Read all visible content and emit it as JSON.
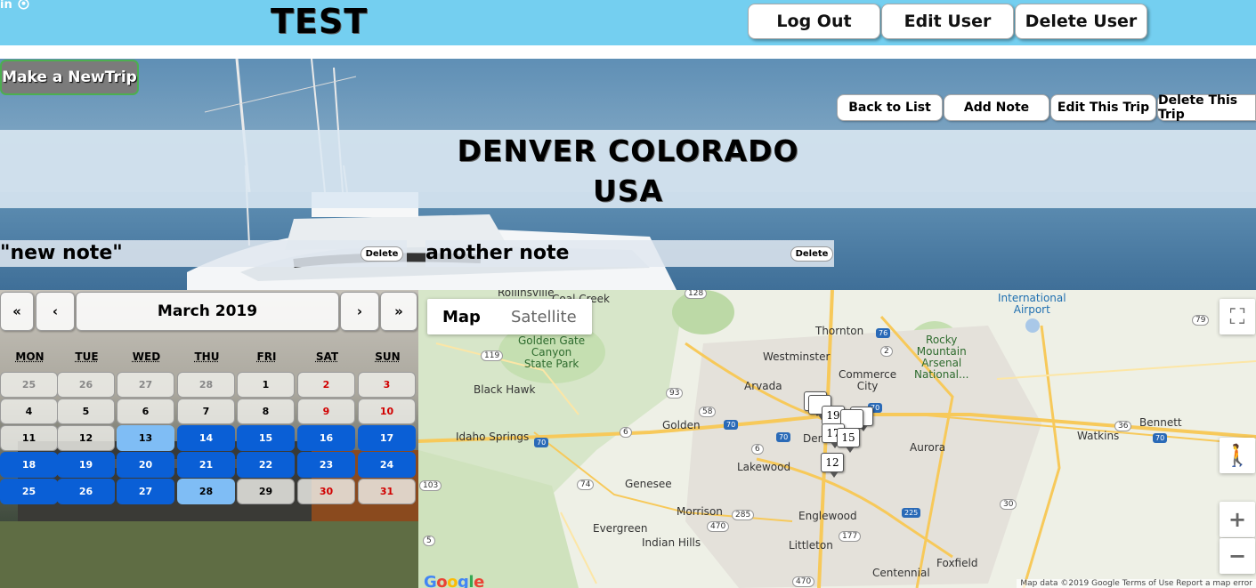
{
  "header": {
    "icons": [
      "in",
      "github-icon"
    ],
    "title": "TEST",
    "buttons": {
      "logout": "Log Out",
      "edit_user": "Edit User",
      "delete_user": "Delete User"
    }
  },
  "trip": {
    "new_trip_label": "Make a NewTrip",
    "actions": {
      "back": "Back to List",
      "add_note": "Add Note",
      "edit": "Edit This Trip",
      "delete": "Delete This Trip"
    },
    "destination": {
      "city": "DENVER COLORADO",
      "country": "USA"
    },
    "notes": [
      {
        "text": "\"new note\"",
        "delete_label": "Delete"
      },
      {
        "text": "another note",
        "delete_label": "Delete"
      }
    ]
  },
  "calendar": {
    "nav": {
      "prev_year": "«",
      "prev_month": "‹",
      "month_label": "March 2019",
      "next_month": "›",
      "next_year": "»"
    },
    "weekdays": [
      "MON",
      "TUE",
      "WED",
      "THU",
      "FRI",
      "SAT",
      "SUN"
    ],
    "weeks": [
      [
        "25",
        "26",
        "27",
        "28",
        "1",
        "2",
        "3"
      ],
      [
        "4",
        "5",
        "6",
        "7",
        "8",
        "9",
        "10"
      ],
      [
        "11",
        "12",
        "13",
        "14",
        "15",
        "16",
        "17"
      ],
      [
        "18",
        "19",
        "20",
        "21",
        "22",
        "23",
        "24"
      ],
      [
        "25",
        "26",
        "27",
        "28",
        "29",
        "30",
        "31"
      ]
    ],
    "selected_range": [
      "13",
      "28"
    ]
  },
  "map": {
    "toggle": {
      "map": "Map",
      "satellite": "Satellite"
    },
    "places": {
      "international_airport": "International\nAirport",
      "thornton": "Thornton",
      "westminster": "Westminster",
      "arvada": "Arvada",
      "commerce_city": "Commerce\nCity",
      "rocky_mountain": "Rocky\nMountain\nArsenal\nNational...",
      "golden_gate": "Golden Gate\nCanyon\nState Park",
      "black_hawk": "Black Hawk",
      "idaho_springs": "Idaho Springs",
      "golden": "Golden",
      "denver": "Den",
      "aurora": "Aurora",
      "lakewood": "Lakewood",
      "genesee": "Genesee",
      "evergreen": "Evergreen",
      "morrison": "Morrison",
      "englewood": "Englewood",
      "indian_hills": "Indian Hills",
      "littleton": "Littleton",
      "centennial": "Centennial",
      "foxfield": "Foxfield",
      "watkins": "Watkins",
      "bennett": "Bennett",
      "coal_creek": "Coal Creek",
      "rollinsville": "Rollinsville"
    },
    "markers": [
      "19",
      "17",
      "15",
      "12"
    ],
    "footer": "Map data ©2019 Google   Terms of Use   Report a map error",
    "logo": "Google"
  }
}
